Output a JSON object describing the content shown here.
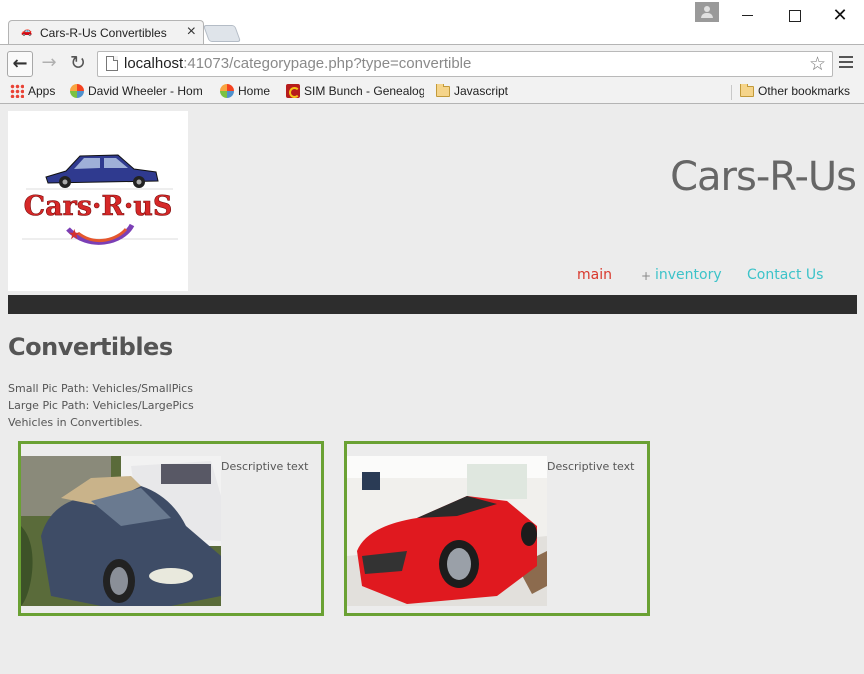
{
  "browser": {
    "tab_title": "Cars-R-Us Convertibles",
    "tab_close": "×",
    "window_close": "✕",
    "url_host": "localhost",
    "url_rest": ":41073/categorypage.php?type=convertible",
    "star": "☆",
    "back": "←",
    "forward": "→",
    "reload": "↻"
  },
  "bookmarks": {
    "items": [
      {
        "label": "Apps",
        "icon": "apps-grid-icon"
      },
      {
        "label": "David Wheeler - Hom",
        "icon": "joomla-icon"
      },
      {
        "label": "Home",
        "icon": "joomla-icon"
      },
      {
        "label": "SIM Bunch - Genealog",
        "icon": "sim-icon"
      },
      {
        "label": "Javascript",
        "icon": "folder-icon"
      }
    ],
    "other": "Other bookmarks"
  },
  "site": {
    "logo_text": "Cars·R·uS",
    "title": "Cars-R-Us",
    "nav": {
      "main": "main",
      "plus": "+",
      "inventory": "inventory",
      "contact": "Contact Us"
    },
    "colors": {
      "nav_active": "#d9382c",
      "nav_link": "#3cc3c9",
      "card_border": "#6aa133",
      "dark_bar": "#2d2d2d"
    }
  },
  "page": {
    "heading": "Convertibles",
    "small_pic_path": "Small Pic Path: Vehicles/SmallPics",
    "large_pic_path": "Large Pic Path: Vehicles/LargePics",
    "vehicles_in": "Vehicles in Convertibles.",
    "cards": [
      {
        "description": "Descriptive text",
        "car_color": "#3e4c66"
      },
      {
        "description": "Descriptive text",
        "car_color": "#e0191f"
      }
    ]
  }
}
